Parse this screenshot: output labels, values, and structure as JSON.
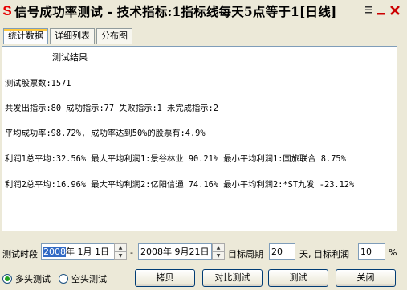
{
  "window": {
    "title": "信号成功率测试 - 技术指标:1指标线每天5点等于1[日线]",
    "app_icon_glyph": "S",
    "icons": [
      "menu-icon",
      "minimize-icon",
      "close-icon"
    ],
    "close_color": "#cc0000"
  },
  "tabs": [
    {
      "label": "统计数据",
      "active": true
    },
    {
      "label": "详细列表",
      "active": false
    },
    {
      "label": "分布图",
      "active": false
    }
  ],
  "results": {
    "heading": "测试结果",
    "lines": [
      "测试股票数:1571",
      "共发出指示:80 成功指示:77 失败指示:1 未完成指示:2",
      "平均成功率:98.72%, 成功率达到50%的股票有:4.9%",
      "利润1总平均:32.56% 最大平均利润1:景谷林业 90.21% 最小平均利润1:国旅联合 8.75%",
      "利润2总平均:16.96% 最大平均利润2:亿阳信通 74.16% 最小平均利润2:*ST九发 -23.12%"
    ]
  },
  "form": {
    "period_label": "测试时段",
    "start_date": {
      "year_selected": "2008",
      "rest": "年  1月  1日"
    },
    "dash": "-",
    "end_date": "2008年  9月21日",
    "target_period_label": "目标周期",
    "target_period_value": "20",
    "target_profit_label": "天, 目标利润",
    "target_profit_value": "10",
    "percent": "%"
  },
  "bottom": {
    "radio_long": "多头测试",
    "radio_short": "空头测试",
    "selected": "long",
    "buttons": {
      "copy": "拷贝",
      "compare": "对比测试",
      "test": "测试",
      "close": "关闭"
    }
  }
}
